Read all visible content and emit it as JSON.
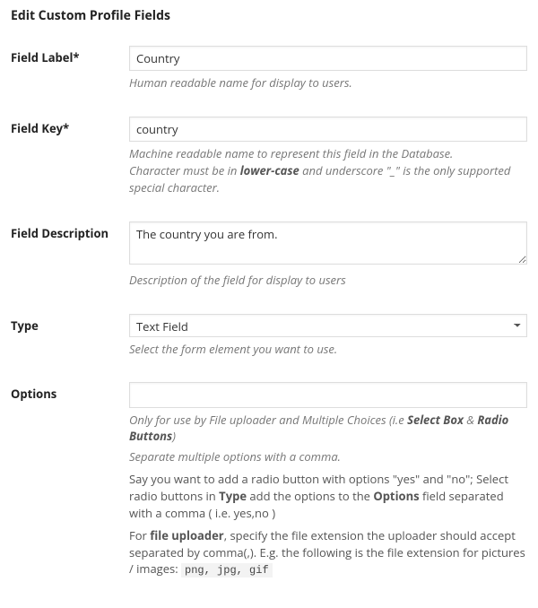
{
  "title": "Edit Custom Profile Fields",
  "fields": {
    "label": {
      "label": "Field Label*",
      "value": "Country",
      "help": "Human readable name for display to users."
    },
    "key": {
      "label": "Field Key*",
      "value": "country",
      "help_line1": "Machine readable name to represent this field in the Database.",
      "help_line2a": "Character must be in ",
      "help_line2_strong1": "lower-case",
      "help_line2b": " and underscore \"_\" is the only supported special character."
    },
    "description": {
      "label": "Field Description",
      "value": "The country you are from.",
      "help": "Description of the field for display to users"
    },
    "type": {
      "label": "Type",
      "value": "Text Field",
      "help": "Select the form element you want to use."
    },
    "options": {
      "label": "Options",
      "value": "",
      "help1a": "Only for use by File uploader and Multiple Choices (i.e ",
      "help1_strong1": "Select Box",
      "help1_amp": " & ",
      "help1_strong2": "Radio Buttons",
      "help1b": ")",
      "help2": "Separate multiple options with a comma.",
      "help3a": "Say you want to add a radio button with options \"yes\" and \"no\"; Select radio buttons in ",
      "help3_strong1": "Type",
      "help3b": " add the options to the ",
      "help3_strong2": "Options",
      "help3c": " field separated with a comma ( i.e. yes,no )",
      "help4a": "For ",
      "help4_strong1": "file uploader",
      "help4b": ", specify the file extension the uploader should accept separated by comma(,). E.g. the following is the file extension for pictures / images: ",
      "help4_code": "png, jpg, gif"
    }
  }
}
